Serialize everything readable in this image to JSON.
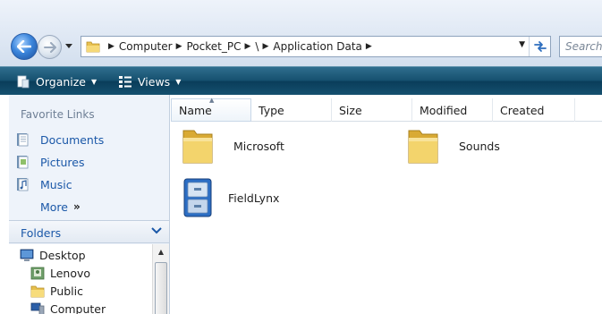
{
  "address_bar": {
    "crumbs": [
      "Computer",
      "Pocket_PC",
      "\\",
      "Application Data"
    ],
    "search_placeholder": "Search"
  },
  "toolbar": {
    "organize_label": "Organize",
    "views_label": "Views"
  },
  "nav_pane": {
    "favorites_title": "Favorite Links",
    "favorites": [
      {
        "label": "Documents",
        "icon": "documents-icon"
      },
      {
        "label": "Pictures",
        "icon": "pictures-icon"
      },
      {
        "label": "Music",
        "icon": "music-icon"
      }
    ],
    "more_label": "More",
    "folders_title": "Folders",
    "tree": [
      {
        "label": "Desktop",
        "icon": "desktop-icon"
      },
      {
        "label": "Lenovo",
        "icon": "user-folder-icon"
      },
      {
        "label": "Public",
        "icon": "folder-icon"
      },
      {
        "label": "Computer",
        "icon": "computer-icon"
      }
    ]
  },
  "file_list": {
    "columns": [
      "Name",
      "Type",
      "Size",
      "Modified",
      "Created"
    ],
    "items": [
      {
        "label": "Microsoft",
        "icon": "folder-icon"
      },
      {
        "label": "Sounds",
        "icon": "folder-icon"
      },
      {
        "label": "FieldLynx",
        "icon": "application-icon"
      }
    ]
  },
  "colors": {
    "toolbar": "#16506f",
    "link": "#1b58a8",
    "nav_pane": "#eef3fa"
  }
}
